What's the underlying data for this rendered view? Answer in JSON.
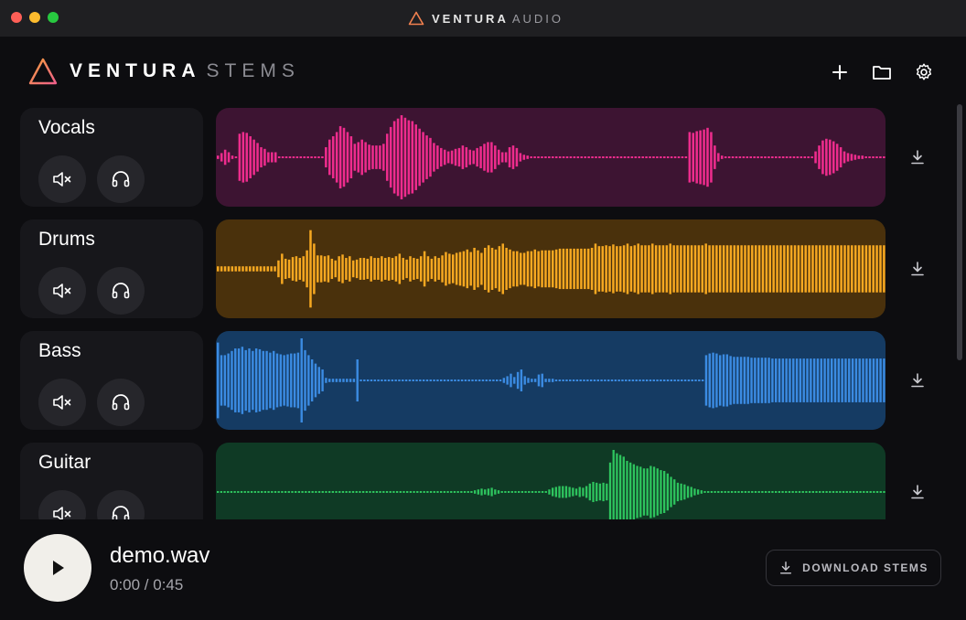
{
  "window": {
    "title_brand": "VENTURA",
    "title_sub": "AUDIO"
  },
  "header": {
    "brand_name": "VENTURA",
    "brand_sub": "STEMS",
    "accent_gradient": [
      "#f6a13b",
      "#ef5f8a"
    ],
    "actions": [
      {
        "icon": "plus-icon"
      },
      {
        "icon": "folder-icon"
      },
      {
        "icon": "gear-icon"
      }
    ]
  },
  "tracks": [
    {
      "name": "Vocals",
      "color": "#ee2c8d",
      "bg": "#3d1432",
      "amplitudes": [
        0.04,
        0.1,
        0.18,
        0.12,
        0.04,
        0.02,
        0.56,
        0.6,
        0.58,
        0.5,
        0.42,
        0.34,
        0.24,
        0.2,
        0.12,
        0.12,
        0.12,
        0.02,
        0.02,
        0.02,
        0.02,
        0.02,
        0.02,
        0.02,
        0.02,
        0.02,
        0.02,
        0.02,
        0.02,
        0.02,
        0.24,
        0.42,
        0.5,
        0.6,
        0.74,
        0.7,
        0.6,
        0.5,
        0.32,
        0.36,
        0.42,
        0.36,
        0.3,
        0.28,
        0.28,
        0.28,
        0.32,
        0.56,
        0.72,
        0.86,
        0.92,
        1.0,
        0.94,
        0.88,
        0.86,
        0.78,
        0.68,
        0.6,
        0.52,
        0.46,
        0.34,
        0.28,
        0.22,
        0.18,
        0.14,
        0.16,
        0.2,
        0.22,
        0.28,
        0.24,
        0.18,
        0.16,
        0.22,
        0.26,
        0.32,
        0.36,
        0.36,
        0.28,
        0.18,
        0.12,
        0.12,
        0.24,
        0.28,
        0.22,
        0.1,
        0.06,
        0.04,
        0.02,
        0.02,
        0.02,
        0.02,
        0.02,
        0.02,
        0.02,
        0.02,
        0.02,
        0.02,
        0.02,
        0.02,
        0.02,
        0.02,
        0.02,
        0.02,
        0.02,
        0.02,
        0.02,
        0.02,
        0.02,
        0.02,
        0.02,
        0.02,
        0.02,
        0.02,
        0.02,
        0.02,
        0.02,
        0.02,
        0.02,
        0.02,
        0.02,
        0.02,
        0.02,
        0.02,
        0.02,
        0.02,
        0.02,
        0.02,
        0.02,
        0.02,
        0.02,
        0.02,
        0.6,
        0.58,
        0.62,
        0.64,
        0.66,
        0.7,
        0.6,
        0.28,
        0.1,
        0.04,
        0.02,
        0.02,
        0.02,
        0.02,
        0.02,
        0.02,
        0.02,
        0.02,
        0.02,
        0.02,
        0.02,
        0.02,
        0.02,
        0.02,
        0.02,
        0.02,
        0.02,
        0.02,
        0.02,
        0.02,
        0.02,
        0.02,
        0.02,
        0.02,
        0.02,
        0.14,
        0.28,
        0.4,
        0.44,
        0.42,
        0.38,
        0.32,
        0.24,
        0.14,
        0.1,
        0.08,
        0.06,
        0.04,
        0.04,
        0.02,
        0.02,
        0.02,
        0.02,
        0.02,
        0.02
      ]
    },
    {
      "name": "Drums",
      "color": "#f6a821",
      "bg": "#4a310c",
      "amplitudes": [
        0.06,
        0.06,
        0.06,
        0.06,
        0.06,
        0.06,
        0.06,
        0.06,
        0.06,
        0.06,
        0.06,
        0.06,
        0.06,
        0.06,
        0.06,
        0.06,
        0.06,
        0.2,
        0.36,
        0.24,
        0.22,
        0.28,
        0.3,
        0.26,
        0.3,
        0.44,
        0.92,
        0.6,
        0.32,
        0.32,
        0.3,
        0.32,
        0.24,
        0.2,
        0.3,
        0.34,
        0.26,
        0.3,
        0.2,
        0.22,
        0.26,
        0.26,
        0.24,
        0.3,
        0.26,
        0.26,
        0.3,
        0.26,
        0.28,
        0.26,
        0.3,
        0.36,
        0.26,
        0.22,
        0.3,
        0.26,
        0.24,
        0.3,
        0.42,
        0.3,
        0.24,
        0.3,
        0.26,
        0.32,
        0.4,
        0.36,
        0.34,
        0.38,
        0.4,
        0.42,
        0.46,
        0.4,
        0.5,
        0.44,
        0.38,
        0.5,
        0.56,
        0.5,
        0.46,
        0.54,
        0.6,
        0.5,
        0.46,
        0.42,
        0.42,
        0.38,
        0.38,
        0.42,
        0.42,
        0.46,
        0.42,
        0.44,
        0.44,
        0.44,
        0.44,
        0.46,
        0.48,
        0.48,
        0.48,
        0.48,
        0.48,
        0.48,
        0.48,
        0.48,
        0.48,
        0.5,
        0.6,
        0.54,
        0.54,
        0.56,
        0.54,
        0.58,
        0.54,
        0.54,
        0.56,
        0.6,
        0.54,
        0.56,
        0.6,
        0.56,
        0.56,
        0.56,
        0.6,
        0.56,
        0.56,
        0.56,
        0.56,
        0.6,
        0.56,
        0.56,
        0.56,
        0.56,
        0.56,
        0.56,
        0.56,
        0.56,
        0.56,
        0.6,
        0.56,
        0.56,
        0.56,
        0.56,
        0.56,
        0.56,
        0.56,
        0.56,
        0.56,
        0.56,
        0.56,
        0.56,
        0.56,
        0.56,
        0.56,
        0.56,
        0.56,
        0.56,
        0.56,
        0.56,
        0.56,
        0.56,
        0.56,
        0.56,
        0.56,
        0.56,
        0.56,
        0.56,
        0.56,
        0.56,
        0.56,
        0.56,
        0.56,
        0.56,
        0.56,
        0.56,
        0.56,
        0.56,
        0.56,
        0.56,
        0.56,
        0.56,
        0.56,
        0.56,
        0.56,
        0.56,
        0.56,
        0.56,
        0.56,
        0.56
      ]
    },
    {
      "name": "Bass",
      "color": "#3b8be2",
      "bg": "#153b63",
      "amplitudes": [
        0.9,
        0.6,
        0.6,
        0.64,
        0.7,
        0.76,
        0.76,
        0.8,
        0.72,
        0.76,
        0.7,
        0.76,
        0.74,
        0.7,
        0.7,
        0.66,
        0.7,
        0.64,
        0.62,
        0.6,
        0.62,
        0.64,
        0.64,
        0.66,
        1.0,
        0.72,
        0.6,
        0.5,
        0.4,
        0.32,
        0.26,
        0.06,
        0.04,
        0.04,
        0.04,
        0.04,
        0.04,
        0.04,
        0.04,
        0.04,
        0.5,
        0.02,
        0.02,
        0.02,
        0.02,
        0.02,
        0.02,
        0.02,
        0.02,
        0.02,
        0.02,
        0.02,
        0.02,
        0.02,
        0.02,
        0.02,
        0.02,
        0.02,
        0.02,
        0.02,
        0.02,
        0.02,
        0.02,
        0.02,
        0.02,
        0.02,
        0.02,
        0.02,
        0.02,
        0.02,
        0.02,
        0.02,
        0.02,
        0.02,
        0.02,
        0.02,
        0.02,
        0.02,
        0.02,
        0.02,
        0.02,
        0.02,
        0.06,
        0.1,
        0.16,
        0.08,
        0.2,
        0.26,
        0.1,
        0.06,
        0.04,
        0.04,
        0.14,
        0.16,
        0.04,
        0.04,
        0.04,
        0.02,
        0.02,
        0.02,
        0.02,
        0.02,
        0.02,
        0.02,
        0.02,
        0.02,
        0.02,
        0.02,
        0.02,
        0.02,
        0.02,
        0.02,
        0.02,
        0.02,
        0.02,
        0.02,
        0.02,
        0.02,
        0.02,
        0.02,
        0.02,
        0.02,
        0.02,
        0.02,
        0.02,
        0.02,
        0.02,
        0.02,
        0.02,
        0.02,
        0.02,
        0.02,
        0.02,
        0.02,
        0.02,
        0.02,
        0.02,
        0.02,
        0.02,
        0.02,
        0.6,
        0.64,
        0.66,
        0.64,
        0.6,
        0.62,
        0.62,
        0.58,
        0.56,
        0.56,
        0.56,
        0.56,
        0.56,
        0.54,
        0.54,
        0.54,
        0.54,
        0.54,
        0.54,
        0.52,
        0.52,
        0.52,
        0.52,
        0.52,
        0.52,
        0.52,
        0.52,
        0.52,
        0.52,
        0.52,
        0.52,
        0.52,
        0.52,
        0.52,
        0.52,
        0.52,
        0.52,
        0.52,
        0.52,
        0.52,
        0.52,
        0.52,
        0.52,
        0.52,
        0.52,
        0.52,
        0.52,
        0.52,
        0.52,
        0.52,
        0.52,
        0.52
      ]
    },
    {
      "name": "Guitar",
      "color": "#2ec45e",
      "bg": "#0f3a25",
      "amplitudes": [
        0.02,
        0.02,
        0.02,
        0.02,
        0.02,
        0.02,
        0.02,
        0.02,
        0.02,
        0.02,
        0.02,
        0.02,
        0.02,
        0.02,
        0.02,
        0.02,
        0.02,
        0.02,
        0.02,
        0.02,
        0.02,
        0.02,
        0.02,
        0.02,
        0.02,
        0.02,
        0.02,
        0.02,
        0.02,
        0.02,
        0.02,
        0.02,
        0.02,
        0.02,
        0.02,
        0.02,
        0.02,
        0.02,
        0.02,
        0.02,
        0.02,
        0.02,
        0.02,
        0.02,
        0.02,
        0.02,
        0.02,
        0.02,
        0.02,
        0.02,
        0.02,
        0.02,
        0.02,
        0.02,
        0.02,
        0.02,
        0.02,
        0.02,
        0.02,
        0.02,
        0.02,
        0.02,
        0.02,
        0.02,
        0.02,
        0.02,
        0.02,
        0.02,
        0.02,
        0.02,
        0.02,
        0.02,
        0.02,
        0.02,
        0.02,
        0.02,
        0.04,
        0.06,
        0.08,
        0.06,
        0.08,
        0.1,
        0.06,
        0.04,
        0.02,
        0.02,
        0.02,
        0.02,
        0.02,
        0.02,
        0.02,
        0.02,
        0.02,
        0.02,
        0.02,
        0.02,
        0.02,
        0.02,
        0.06,
        0.1,
        0.12,
        0.14,
        0.14,
        0.14,
        0.12,
        0.1,
        0.08,
        0.12,
        0.1,
        0.14,
        0.2,
        0.24,
        0.22,
        0.2,
        0.22,
        0.2,
        0.7,
        1.0,
        0.92,
        0.88,
        0.84,
        0.74,
        0.7,
        0.66,
        0.62,
        0.6,
        0.56,
        0.56,
        0.62,
        0.6,
        0.56,
        0.52,
        0.5,
        0.44,
        0.36,
        0.3,
        0.22,
        0.2,
        0.18,
        0.14,
        0.12,
        0.08,
        0.06,
        0.04,
        0.02,
        0.02,
        0.02,
        0.02,
        0.02,
        0.02,
        0.02,
        0.02,
        0.02,
        0.02,
        0.02,
        0.02,
        0.02,
        0.02,
        0.02,
        0.02,
        0.02,
        0.02,
        0.02,
        0.02,
        0.02,
        0.02,
        0.02,
        0.02,
        0.02,
        0.02,
        0.02,
        0.02,
        0.02,
        0.02,
        0.02,
        0.02,
        0.02,
        0.02,
        0.02,
        0.02,
        0.02,
        0.02,
        0.02,
        0.02,
        0.02,
        0.02,
        0.02,
        0.02,
        0.02,
        0.02,
        0.02,
        0.02,
        0.02,
        0.02,
        0.02,
        0.02,
        0.02,
        0.02
      ]
    }
  ],
  "player": {
    "file_name": "demo.wav",
    "time": "0:00 / 0:45",
    "download_label": "DOWNLOAD STEMS"
  }
}
